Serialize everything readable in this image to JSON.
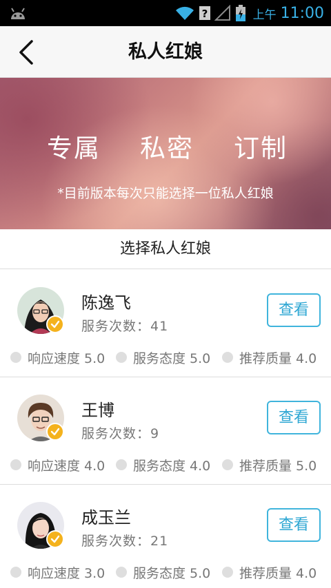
{
  "status_bar": {
    "ampm": "上午",
    "time": "11:00"
  },
  "nav": {
    "title": "私人红娘"
  },
  "banner": {
    "words": [
      "专属",
      "私密",
      "订制"
    ],
    "note": "*目前版本每次只能选择一位私人红娘"
  },
  "section": {
    "title": "选择私人红娘"
  },
  "matchmakers": [
    {
      "name": "陈逸飞",
      "count_label": "服务次数：41",
      "button_label": "查看",
      "ratings": [
        "响应速度 5.0",
        "服务态度 5.0",
        "推荐质量 4.0"
      ]
    },
    {
      "name": "王博",
      "count_label": "服务次数：9",
      "button_label": "查看",
      "ratings": [
        "响应速度 4.0",
        "服务态度 4.0",
        "推荐质量 5.0"
      ]
    },
    {
      "name": "成玉兰",
      "count_label": "服务次数：21",
      "button_label": "查看",
      "ratings": [
        "响应速度 3.0",
        "服务态度 5.0",
        "推荐质量 4.0"
      ]
    }
  ],
  "colors": {
    "accent": "#3fb4dc",
    "badge": "#f4b21d",
    "status_text": "#39b1e6"
  },
  "icons": {
    "back": "chevron-left-icon",
    "verified": "check-badge-icon",
    "rating_dot": "dot-icon"
  }
}
